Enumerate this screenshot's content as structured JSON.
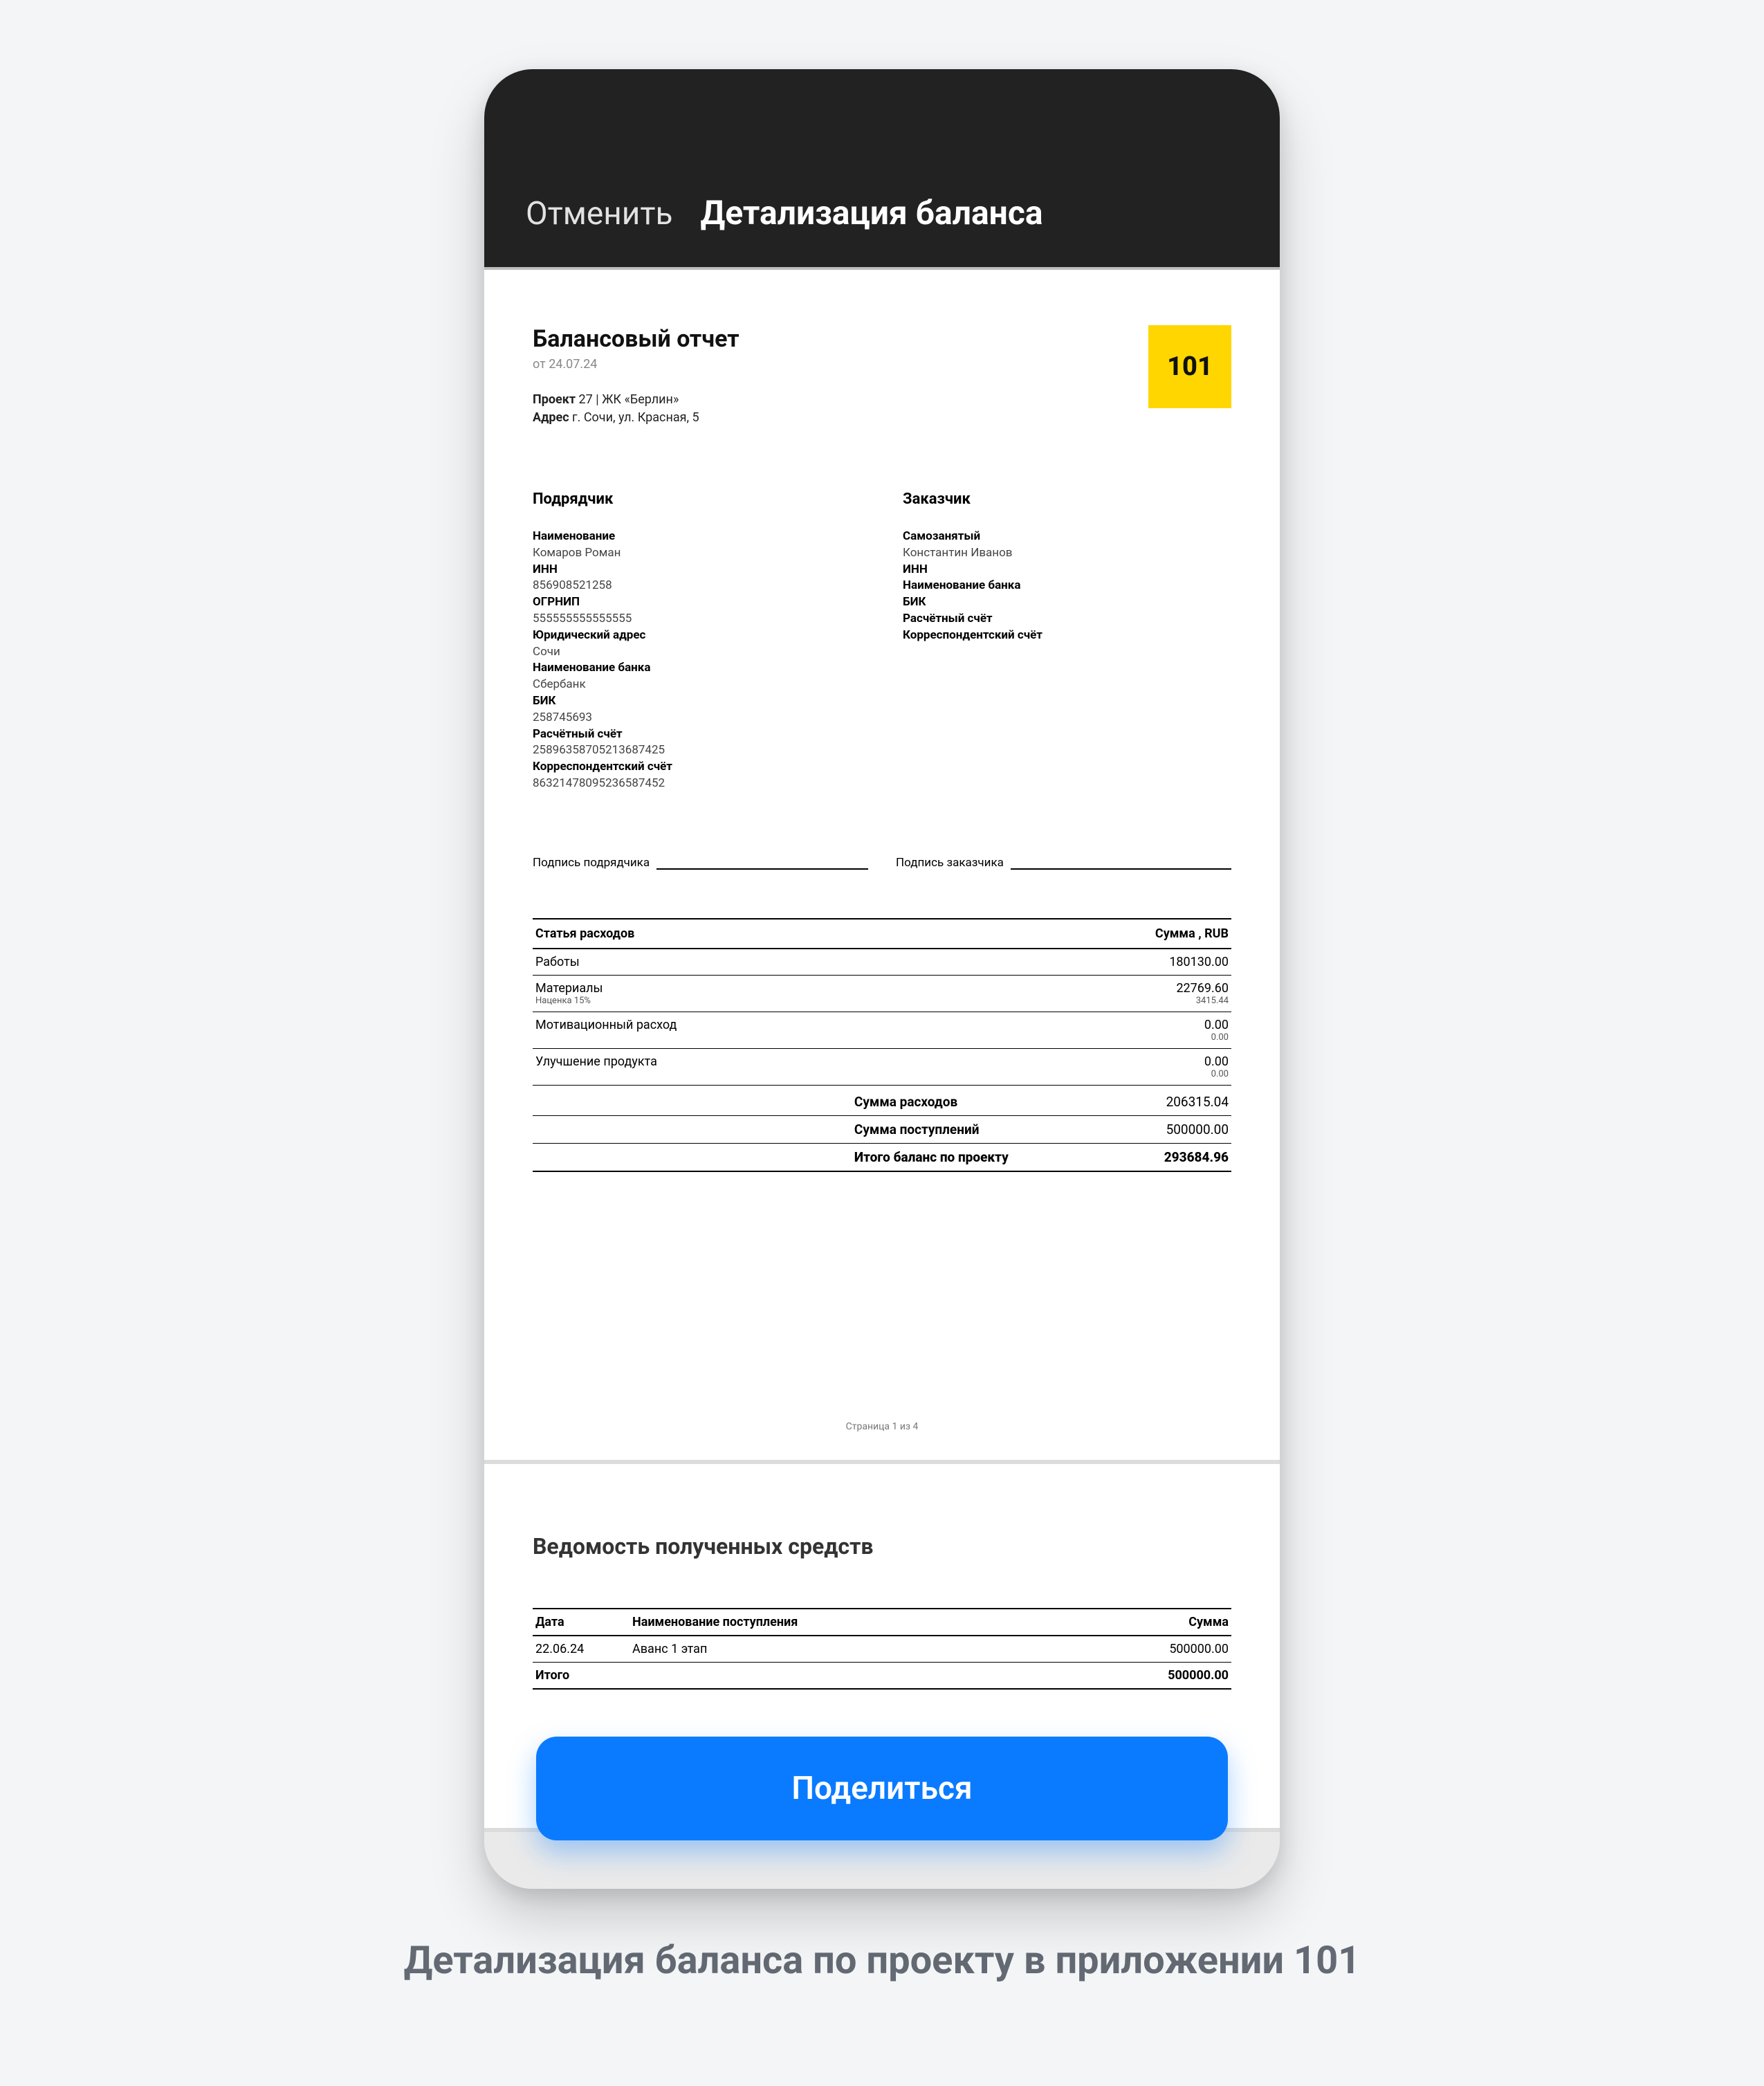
{
  "header": {
    "cancel_label": "Отменить",
    "title": "Детализация баланса"
  },
  "report": {
    "title": "Балансовый отчет",
    "date_prefix": "от 24.07.24",
    "logo_text": "101",
    "project_label": "Проект",
    "project_value": "27 | ЖК «Берлин»",
    "address_label": "Адрес",
    "address_value": "г. Сочи, ул. Красная, 5"
  },
  "contractor": {
    "heading": "Подрядчик",
    "name_label": "Наименование",
    "name_value": "Комаров Роман",
    "inn_label": "ИНН",
    "inn_value": "856908521258",
    "ogrnip_label": "ОГРНИП",
    "ogrnip_value": "555555555555555",
    "legal_addr_label": "Юридический адрес",
    "legal_addr_value": "Сочи",
    "bank_label": "Наименование банка",
    "bank_value": "Сбербанк",
    "bik_label": "БИК",
    "bik_value": "258745693",
    "acc_label": "Расчётный счёт",
    "acc_value": "25896358705213687425",
    "corr_label": "Корреспондентский счёт",
    "corr_value": "86321478095236587452"
  },
  "customer": {
    "heading": "Заказчик",
    "status_label": "Самозанятый",
    "name_value": "Константин Иванов",
    "inn_label": "ИНН",
    "bank_label": "Наименование банка",
    "bik_label": "БИК",
    "acc_label": "Расчётный счёт",
    "corr_label": "Корреспондентский счёт"
  },
  "signatures": {
    "contractor": "Подпись подрядчика",
    "customer": "Подпись заказчика"
  },
  "expense_table": {
    "col_item": "Статья расходов",
    "col_sum": "Сумма , RUB",
    "rows": [
      {
        "item": "Работы",
        "sum": "180130.00"
      },
      {
        "item": "Материалы",
        "item_sub": "Наценка 15%",
        "sum": "22769.60",
        "sum_sub": "3415.44"
      },
      {
        "item": "Мотивационный расход",
        "sum": "0.00",
        "sum_sub": "0.00"
      },
      {
        "item": "Улучшение продукта",
        "sum": "0.00",
        "sum_sub": "0.00"
      }
    ]
  },
  "totals": {
    "expenses_label": "Сумма расходов",
    "expenses_value": "206315.04",
    "income_label": "Сумма поступлений",
    "income_value": "500000.00",
    "balance_label": "Итого баланс по проекту",
    "balance_value": "293684.96"
  },
  "page_number": "Страница 1 из 4",
  "page2": {
    "title": "Ведомость полученных средств",
    "col_date": "Дата",
    "col_name": "Наименование поступления",
    "col_sum": "Сумма",
    "rows": [
      {
        "date": "22.06.24",
        "name": "Аванс 1 этап",
        "sum": "500000.00"
      }
    ],
    "total_label": "Итого",
    "total_value": "500000.00"
  },
  "share_label": "Поделиться",
  "caption": "Детализация баланса по проекту в приложении 101"
}
